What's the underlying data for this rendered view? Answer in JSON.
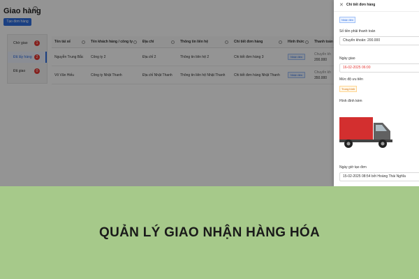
{
  "page": {
    "title": "Giao hàng",
    "create_button": "Tạo đơn hàng"
  },
  "side_tabs": [
    {
      "label": "Chờ giao",
      "count": "1"
    },
    {
      "label": "Đã lấy hàng",
      "count": "2"
    },
    {
      "label": "Đã giao",
      "count": "0"
    }
  ],
  "table": {
    "headers": [
      "Tên tài xế",
      "Tên khách hàng / công ty",
      "Địa chỉ",
      "Thông tin liên hệ",
      "Chi tiết đơn hàng",
      "Hình thức",
      "Thanh toán"
    ],
    "rows": [
      {
        "driver": "Nguyễn Trung Bắc",
        "customer": "Công ty 2",
        "address": "Địa chỉ 2",
        "contact": "Thông tin liên hệ 2",
        "detail": "Chi tiết đơn hàng 3",
        "type": "Nhận tiền",
        "pay_method": "Chuyển kh",
        "pay_amount": "200.000"
      },
      {
        "driver": "Võ Văn Hiếu",
        "customer": "Công ty Nhật Thanh",
        "address": "Địa chỉ Nhật Thanh",
        "contact": "Thông tin liên hệ Nhật Thanh",
        "detail": "Chi tiết đơn hàng Nhật Thanh",
        "type": "Nhận tiền",
        "pay_method": "Chuyển kh",
        "pay_amount": "350.000"
      }
    ]
  },
  "panel": {
    "title": "Chi tiết đơn hàng",
    "status_tag": "Nhận tiền",
    "amount_label": "Số tiền phải thanh toán",
    "amount_value": "Chuyển khoản: 200.000",
    "date_label": "Ngày giao",
    "date_value": "16-02-2025 06:00",
    "priority_label": "Mức độ ưu tiên",
    "priority_value": "Trung bình",
    "image_label": "Hình đính kèm",
    "created_label": "Ngày giờ tạo đơn",
    "created_value": "15-02-2025 08:54 bởi Hoàng Thái Nghĩa"
  },
  "caption": "QUẢN LÝ GIAO NHẬN HÀNG HÓA",
  "colors": {
    "primary": "#2f6fe0",
    "badge_red": "#e53935",
    "caption_bg": "#a6c98a",
    "truck_body": "#d32f2f",
    "truck_cab": "#616161"
  }
}
